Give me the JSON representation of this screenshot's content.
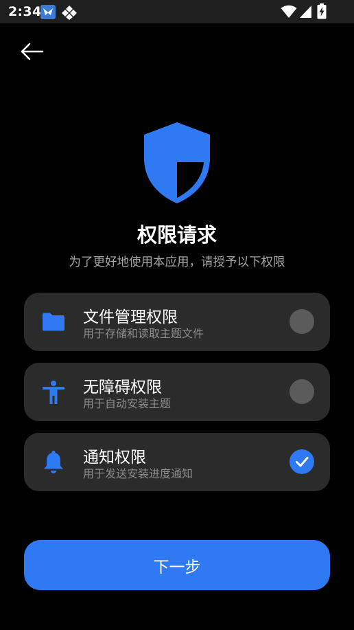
{
  "status_bar": {
    "time": "2:34",
    "icons": [
      "notification-app-icon",
      "notification-diamond-icon",
      "wifi-icon",
      "signal-icon",
      "battery-charging-icon"
    ]
  },
  "header": {
    "back_icon": "back-arrow-icon",
    "shield_icon": "shield-icon"
  },
  "title": "权限请求",
  "subtitle": "为了更好地使用本应用，请授予以下权限",
  "permissions": [
    {
      "icon": "folder-icon",
      "title": "文件管理权限",
      "desc": "用于存储和读取主题文件",
      "granted": false
    },
    {
      "icon": "accessibility-icon",
      "title": "无障碍权限",
      "desc": "用于自动安装主题",
      "granted": false
    },
    {
      "icon": "bell-icon",
      "title": "通知权限",
      "desc": "用于发送安装进度通知",
      "granted": true
    }
  ],
  "next_button_label": "下一步",
  "colors": {
    "accent": "#2f7af3",
    "background": "#000000",
    "card": "#2b2b2b",
    "toggle_off": "#5b5b5b",
    "subtitle": "#a6a6a6",
    "desc": "#8c8c8c"
  }
}
